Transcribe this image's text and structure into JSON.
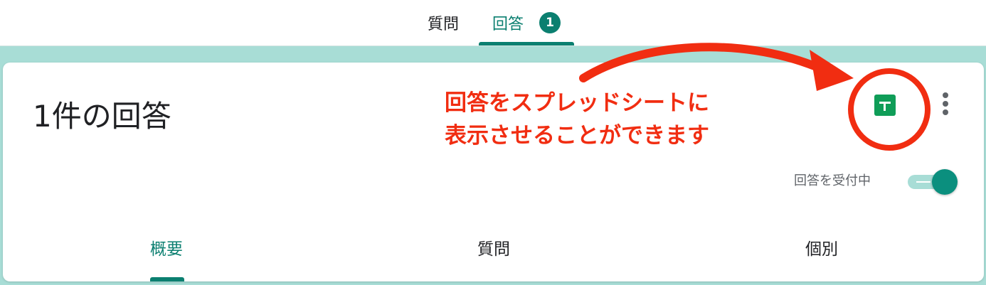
{
  "header": {
    "tabs": [
      {
        "label": "質問"
      },
      {
        "label": "回答",
        "badge": "1"
      }
    ]
  },
  "card": {
    "title": "1件の回答",
    "annotation": {
      "line1": "回答をスプレッドシートに",
      "line2": "表示させることができます"
    },
    "accepting_label": "回答を受付中",
    "accepting_on": true,
    "subtabs": [
      {
        "label": "概要"
      },
      {
        "label": "質問"
      },
      {
        "label": "個別"
      }
    ]
  },
  "colors": {
    "accent": "#0b7f70",
    "annotation_red": "#f12d11",
    "sheets_green": "#0f9d58",
    "background": "#a8ddd6"
  },
  "icons": [
    "sheets-icon",
    "more-vert-icon",
    "arrow-annotation"
  ]
}
